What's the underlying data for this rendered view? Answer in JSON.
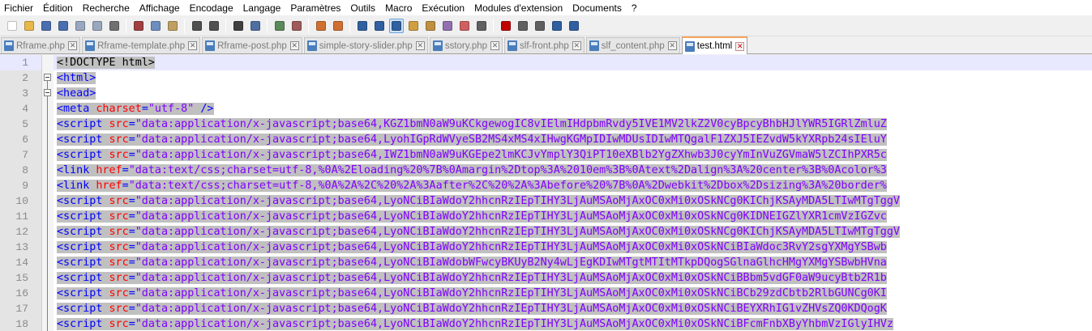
{
  "menu": [
    "Fichier",
    "Édition",
    "Recherche",
    "Affichage",
    "Encodage",
    "Langage",
    "Paramètres",
    "Outils",
    "Macro",
    "Exécution",
    "Modules d'extension",
    "Documents",
    "?"
  ],
  "toolbar": {
    "buttons": [
      {
        "name": "new-file-icon",
        "color": "#ffffff",
        "active": false
      },
      {
        "name": "open-folder-icon",
        "color": "#e8b84a",
        "active": false
      },
      {
        "name": "save-icon",
        "color": "#4a6fb0",
        "active": false
      },
      {
        "name": "save-all-icon",
        "color": "#4a6fb0",
        "active": false
      },
      {
        "name": "close-icon",
        "color": "#9aa8bf",
        "active": false
      },
      {
        "name": "close-all-icon",
        "color": "#9aa8bf",
        "active": false
      },
      {
        "name": "print-icon",
        "color": "#707070",
        "active": false
      },
      {
        "sep": true
      },
      {
        "name": "cut-icon",
        "color": "#a04040",
        "active": false
      },
      {
        "name": "copy-icon",
        "color": "#6d8fbf",
        "active": false
      },
      {
        "name": "paste-icon",
        "color": "#c0a060",
        "active": false
      },
      {
        "sep": true
      },
      {
        "name": "undo-icon",
        "color": "#505050",
        "active": false
      },
      {
        "name": "redo-icon",
        "color": "#505050",
        "active": false
      },
      {
        "sep": true
      },
      {
        "name": "find-icon",
        "color": "#404040",
        "active": false
      },
      {
        "name": "replace-icon",
        "color": "#4f6fa0",
        "active": false
      },
      {
        "sep": true
      },
      {
        "name": "zoom-in-icon",
        "color": "#5a8a5a",
        "active": false
      },
      {
        "name": "zoom-out-icon",
        "color": "#a05a5a",
        "active": false
      },
      {
        "sep": true
      },
      {
        "name": "sync-vertical-icon",
        "color": "#d07030",
        "active": false
      },
      {
        "name": "sync-horizontal-icon",
        "color": "#d07030",
        "active": false
      },
      {
        "sep": true
      },
      {
        "name": "word-wrap-icon",
        "color": "#3060a0",
        "active": false
      },
      {
        "name": "show-all-chars-icon",
        "color": "#3060a0",
        "active": false
      },
      {
        "name": "indent-guide-icon",
        "color": "#3060a0",
        "active": true
      },
      {
        "name": "user-language-icon",
        "color": "#d0a040",
        "active": false
      },
      {
        "name": "doc-map-icon",
        "color": "#c09040",
        "active": false
      },
      {
        "name": "function-list-icon",
        "color": "#9070b0",
        "active": false
      },
      {
        "name": "folder-workspace-icon",
        "color": "#d06060",
        "active": false
      },
      {
        "name": "monitor-icon",
        "color": "#606060",
        "active": false
      },
      {
        "sep": true
      },
      {
        "name": "record-macro-icon",
        "color": "#c00000",
        "active": false
      },
      {
        "name": "stop-record-icon",
        "color": "#606060",
        "active": false
      },
      {
        "name": "play-macro-icon",
        "color": "#606060",
        "active": false
      },
      {
        "name": "play-multiple-icon",
        "color": "#3060a0",
        "active": false
      },
      {
        "name": "save-macro-icon",
        "color": "#3060a0",
        "active": false
      }
    ]
  },
  "tabs": [
    {
      "label": "Rframe.php",
      "active": false
    },
    {
      "label": "Rframe-template.php",
      "active": false
    },
    {
      "label": "Rframe-post.php",
      "active": false
    },
    {
      "label": "simple-story-slider.php",
      "active": false
    },
    {
      "label": "sstory.php",
      "active": false
    },
    {
      "label": "slf-front.php",
      "active": false
    },
    {
      "label": "slf_content.php",
      "active": false
    },
    {
      "label": "test.html",
      "active": true
    }
  ],
  "close_glyph": "✕",
  "editor": {
    "current_line": 1,
    "lines": [
      {
        "n": "1",
        "fold": "none",
        "parts": [
          {
            "t": "<!DOCTYPE html>",
            "c": "doctype"
          }
        ]
      },
      {
        "n": "2",
        "fold": "box",
        "parts": [
          {
            "t": "<html>",
            "c": "tag"
          }
        ]
      },
      {
        "n": "3",
        "fold": "box",
        "parts": [
          {
            "t": "<head>",
            "c": "tag"
          }
        ]
      },
      {
        "n": "4",
        "fold": "line",
        "parts": [
          {
            "t": "<meta ",
            "c": "tag"
          },
          {
            "t": "charset",
            "c": "attr"
          },
          {
            "t": "=",
            "c": "tag"
          },
          {
            "t": "\"utf-8\"",
            "c": "val"
          },
          {
            "t": " />",
            "c": "tag"
          }
        ]
      },
      {
        "n": "5",
        "fold": "line",
        "parts": [
          {
            "t": "<script ",
            "c": "tag"
          },
          {
            "t": "src",
            "c": "attr"
          },
          {
            "t": "=",
            "c": "tag"
          },
          {
            "t": "\"data:application/x-javascript;base64,KGZ1bmN0aW9uKCkgewogIC8vIElmIHdpbmRvdy5IVE1MV2lkZ2V0cyBpcyBhbHJlYWR5IGRlZmluZ",
            "c": "val"
          }
        ]
      },
      {
        "n": "6",
        "fold": "line",
        "parts": [
          {
            "t": "<script ",
            "c": "tag"
          },
          {
            "t": "src",
            "c": "attr"
          },
          {
            "t": "=",
            "c": "tag"
          },
          {
            "t": "\"data:application/x-javascript;base64,LyohIGpRdWVyeSB2MS4xMS4xIHwgKGMpIDIwMDUsIDIwMTQgalF1ZXJ5IEZvdW5kYXRpb24sIEluY",
            "c": "val"
          }
        ]
      },
      {
        "n": "7",
        "fold": "line",
        "parts": [
          {
            "t": "<script ",
            "c": "tag"
          },
          {
            "t": "src",
            "c": "attr"
          },
          {
            "t": "=",
            "c": "tag"
          },
          {
            "t": "\"data:application/x-javascript;base64,IWZ1bmN0aW9uKGEpe2lmKCJvYmplY3QiPT10eXBlb2YgZXhwb3J0cyYmInVuZGVmaW5lZCIhPXR5c",
            "c": "val"
          }
        ]
      },
      {
        "n": "8",
        "fold": "line",
        "parts": [
          {
            "t": "<link ",
            "c": "tag"
          },
          {
            "t": "href",
            "c": "attr"
          },
          {
            "t": "=",
            "c": "tag"
          },
          {
            "t": "\"data:text/css;charset=utf-8,%0A%2Eloading%20%7B%0Amargin%2Dtop%3A%2010em%3B%0Atext%2Dalign%3A%20center%3B%0Acolor%3",
            "c": "val"
          }
        ]
      },
      {
        "n": "9",
        "fold": "line",
        "parts": [
          {
            "t": "<link ",
            "c": "tag"
          },
          {
            "t": "href",
            "c": "attr"
          },
          {
            "t": "=",
            "c": "tag"
          },
          {
            "t": "\"data:text/css;charset=utf-8,%0A%2A%2C%20%2A%3Aafter%2C%20%2A%3Abefore%20%7B%0A%2Dwebkit%2Dbox%2Dsizing%3A%20border%",
            "c": "val"
          }
        ]
      },
      {
        "n": "10",
        "fold": "line",
        "parts": [
          {
            "t": "<script ",
            "c": "tag"
          },
          {
            "t": "src",
            "c": "attr"
          },
          {
            "t": "=",
            "c": "tag"
          },
          {
            "t": "\"data:application/x-javascript;base64,LyoNCiBIaWdoY2hhcnRzIEpTIHY3LjAuMSAoMjAxOC0xMi0xOSkNCg0KIChjKSAyMDA5LTIwMTgTggV",
            "c": "val"
          }
        ]
      },
      {
        "n": "11",
        "fold": "line",
        "parts": [
          {
            "t": "<script ",
            "c": "tag"
          },
          {
            "t": "src",
            "c": "attr"
          },
          {
            "t": "=",
            "c": "tag"
          },
          {
            "t": "\"data:application/x-javascript;base64,LyoNCiBIaWdoY2hhcnRzIEpTIHY3LjAuMSAoMjAxOC0xMi0xOSkNCg0KIDNEIGZlYXR1cmVzIGZvc",
            "c": "val"
          }
        ]
      },
      {
        "n": "12",
        "fold": "line",
        "parts": [
          {
            "t": "<script ",
            "c": "tag"
          },
          {
            "t": "src",
            "c": "attr"
          },
          {
            "t": "=",
            "c": "tag"
          },
          {
            "t": "\"data:application/x-javascript;base64,LyoNCiBIaWdoY2hhcnRzIEpTIHY3LjAuMSAoMjAxOC0xMi0xOSkNCg0KIChjKSAyMDA5LTIwMTgTggV",
            "c": "val"
          }
        ]
      },
      {
        "n": "13",
        "fold": "line",
        "parts": [
          {
            "t": "<script ",
            "c": "tag"
          },
          {
            "t": "src",
            "c": "attr"
          },
          {
            "t": "=",
            "c": "tag"
          },
          {
            "t": "\"data:application/x-javascript;base64,LyoNCiBIaWdoY2hhcnRzIEpTIHY3LjAuMSAoMjAxOC0xMi0xOSkNCiBIaWdoc3RvY2sgYXMgYSBwb",
            "c": "val"
          }
        ]
      },
      {
        "n": "14",
        "fold": "line",
        "parts": [
          {
            "t": "<script ",
            "c": "tag"
          },
          {
            "t": "src",
            "c": "attr"
          },
          {
            "t": "=",
            "c": "tag"
          },
          {
            "t": "\"data:application/x-javascript;base64,LyoNCiBIaWdobWFwcyBKUyB2Ny4wLjEgKDIwMTgtMTItMTkpDQogSGlnaGlhcHMgYXMgYSBwbHVna",
            "c": "val"
          }
        ]
      },
      {
        "n": "15",
        "fold": "line",
        "parts": [
          {
            "t": "<script ",
            "c": "tag"
          },
          {
            "t": "src",
            "c": "attr"
          },
          {
            "t": "=",
            "c": "tag"
          },
          {
            "t": "\"data:application/x-javascript;base64,LyoNCiBIaWdoY2hhcnRzIEpTIHY3LjAuMSAoMjAxOC0xMi0xOSkNCiBBbm5vdGF0aW9ucyBtb2R1b",
            "c": "val"
          }
        ]
      },
      {
        "n": "16",
        "fold": "line",
        "parts": [
          {
            "t": "<script ",
            "c": "tag"
          },
          {
            "t": "src",
            "c": "attr"
          },
          {
            "t": "=",
            "c": "tag"
          },
          {
            "t": "\"data:application/x-javascript;base64,LyoNCiBIaWdoY2hhcnRzIEpTIHY3LjAuMSAoMjAxOC0xMi0xOSkNCiBCb29zdCbtb2RlbGUNCg0KI",
            "c": "val"
          }
        ]
      },
      {
        "n": "17",
        "fold": "line",
        "parts": [
          {
            "t": "<script ",
            "c": "tag"
          },
          {
            "t": "src",
            "c": "attr"
          },
          {
            "t": "=",
            "c": "tag"
          },
          {
            "t": "\"data:application/x-javascript;base64,LyoNCiBIaWdoY2hhcnRzIEpTIHY3LjAuMSAoMjAxOC0xMi0xOSkNCiBEYXRhIG1vZHVsZQ0KDQogK",
            "c": "val"
          }
        ]
      },
      {
        "n": "18",
        "fold": "line",
        "parts": [
          {
            "t": "<script ",
            "c": "tag"
          },
          {
            "t": "src",
            "c": "attr"
          },
          {
            "t": "=",
            "c": "tag"
          },
          {
            "t": "\"data:application/x-javascript;base64,LyoNCiBIaWdoY2hhcnRzIEpTIHY3LjAuMSAoMjAxOC0xMi0xOSkNCiBFcmFnbXByYhbmVzIGlyIHVz",
            "c": "val"
          }
        ]
      }
    ]
  }
}
